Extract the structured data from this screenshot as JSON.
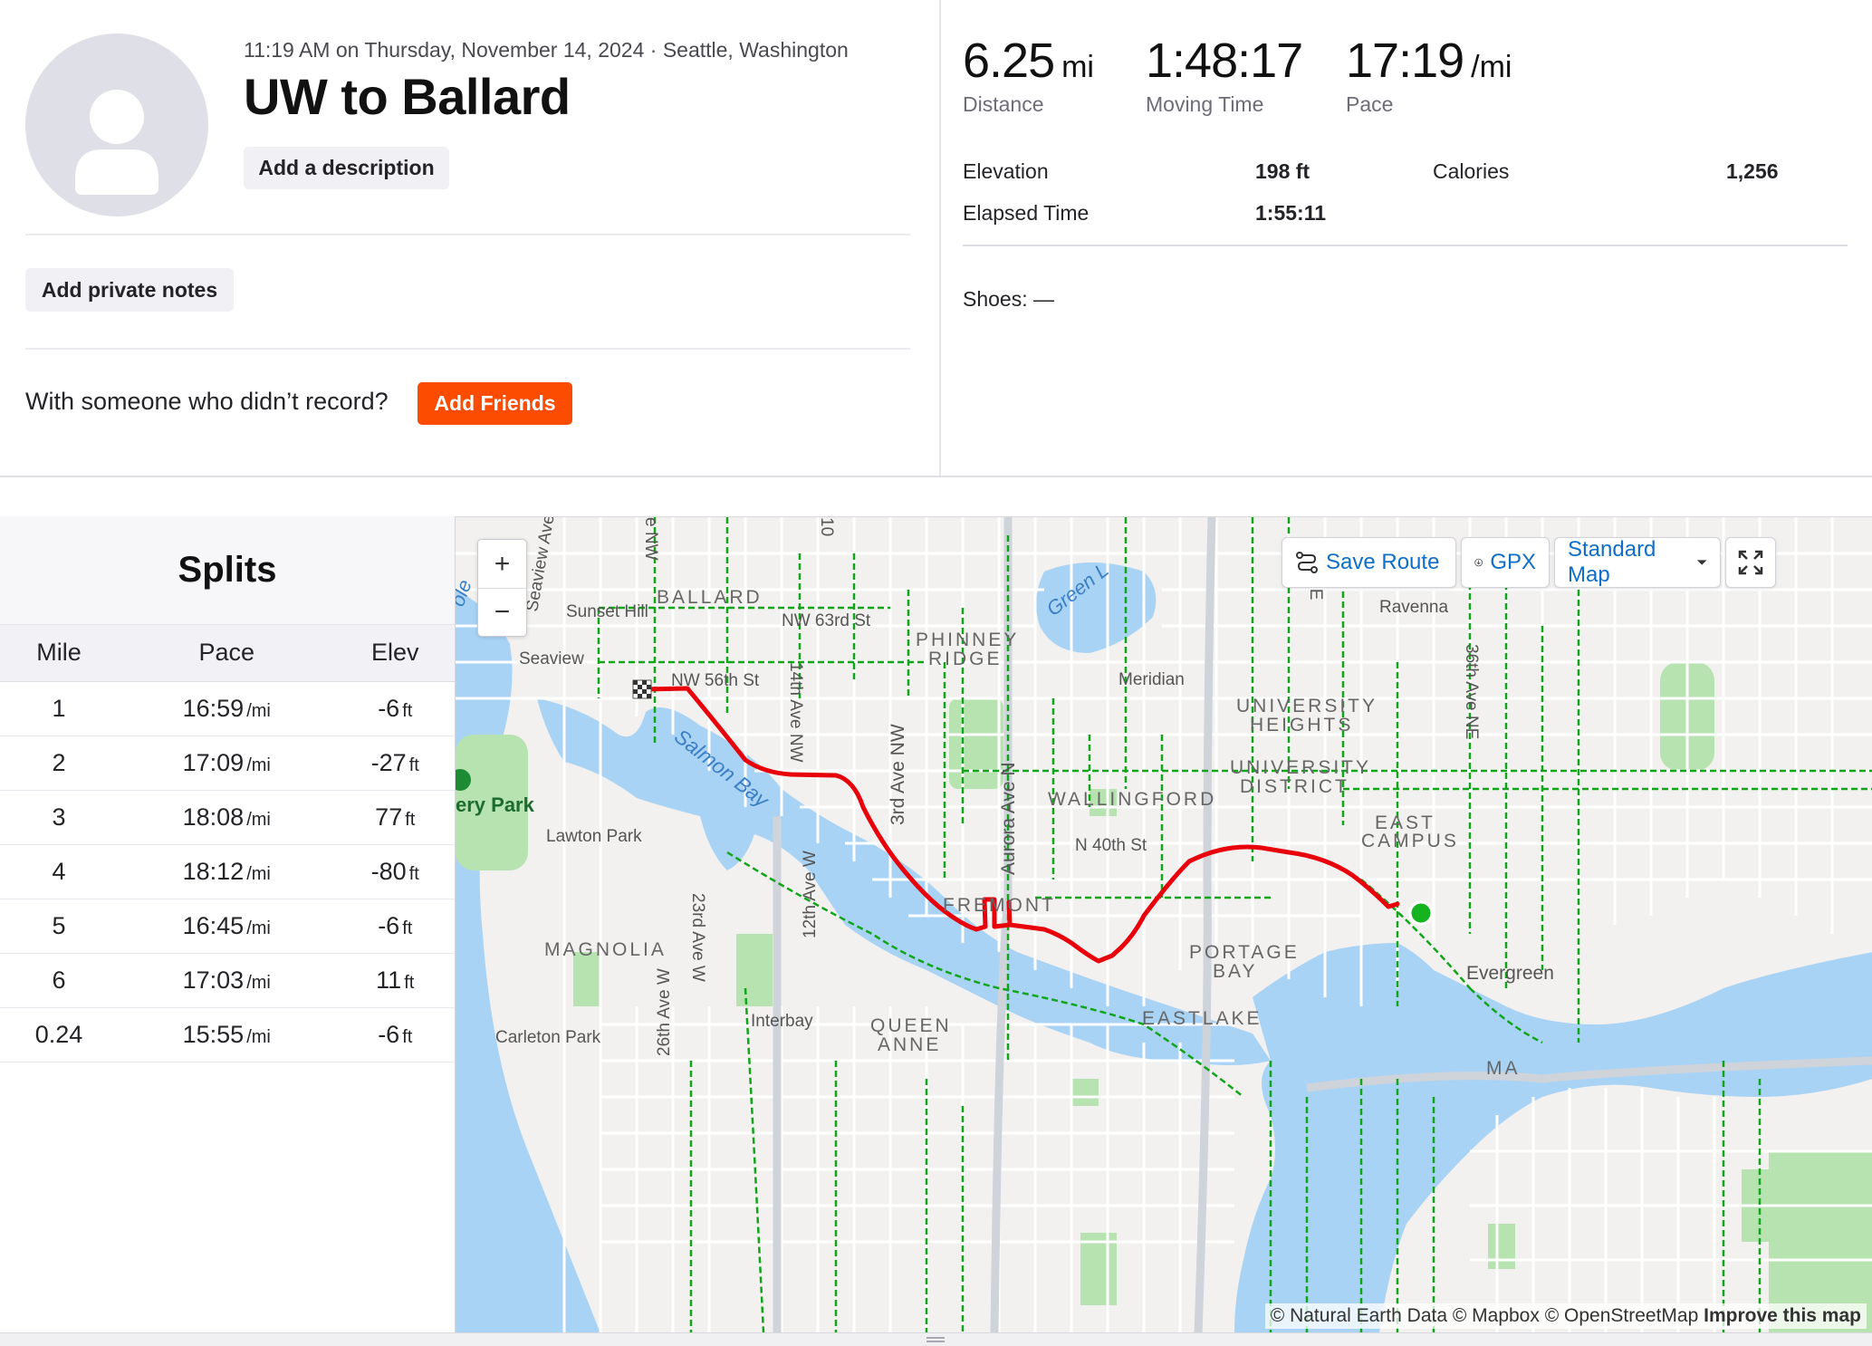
{
  "activity": {
    "datetime": "11:19 AM on Thursday, November 14, 2024 · Seattle, Washington",
    "title": "UW to Ballard",
    "add_description": "Add a description",
    "add_private_notes": "Add private notes",
    "with_someone": "With someone who didn’t record?",
    "add_friends": "Add Friends"
  },
  "stats": {
    "distance": {
      "value": "6.25",
      "unit": "mi",
      "label": "Distance"
    },
    "moving_time": {
      "value": "1:48:17",
      "label": "Moving Time"
    },
    "pace": {
      "value": "17:19",
      "unit": "/mi",
      "label": "Pace"
    },
    "elevation_label": "Elevation",
    "elevation_value": "198 ft",
    "calories_label": "Calories",
    "calories_value": "1,256",
    "elapsed_label": "Elapsed Time",
    "elapsed_value": "1:55:11",
    "shoes": "Shoes: —"
  },
  "splits": {
    "title": "Splits",
    "columns": [
      "Mile",
      "Pace",
      "Elev"
    ],
    "pace_unit": "/mi",
    "elev_unit": "ft",
    "rows": [
      {
        "mile": "1",
        "pace": "16:59",
        "elev": "-6"
      },
      {
        "mile": "2",
        "pace": "17:09",
        "elev": "-27"
      },
      {
        "mile": "3",
        "pace": "18:08",
        "elev": "77"
      },
      {
        "mile": "4",
        "pace": "18:12",
        "elev": "-80"
      },
      {
        "mile": "5",
        "pace": "16:45",
        "elev": "-6"
      },
      {
        "mile": "6",
        "pace": "17:03",
        "elev": "11"
      },
      {
        "mile": "0.24",
        "pace": "15:55",
        "elev": "-6"
      }
    ]
  },
  "map": {
    "zoom_in": "+",
    "zoom_out": "−",
    "save_route": "Save Route",
    "gpx": "GPX",
    "map_type": "Standard Map",
    "attribution": "© Natural Earth Data © Mapbox © OpenStreetMap",
    "improve": "Improve this map",
    "labels": {
      "ballard": "BALLARD",
      "sunset_hill": "Sunset Hill",
      "nw63": "NW 63rd St",
      "nw56": "NW 56th St",
      "seaview": "Seaview",
      "seaview_ave": "Seaview Ave",
      "salmon_bay": "Salmon Bay",
      "phinney": "PHINNEY",
      "ridge": "RIDGE",
      "green_lake": "Green L",
      "meridian": "Meridian",
      "ravenna": "Ravenna",
      "university": "UNIVERSITY",
      "heights": "HEIGHTS",
      "university2": "UNIVERSITY",
      "district": "DISTRICT",
      "wallingford": "WALLINGFORD",
      "n40": "N 40th St",
      "east": "EAST",
      "campus": "CAMPUS",
      "fremont": "FREMONT",
      "portage": "PORTAGE",
      "bay": "BAY",
      "eastlake": "EASTLAKE",
      "queen": "QUEEN",
      "anne": "ANNE",
      "magnolia": "MAGNOLIA",
      "lawton": "Lawton Park",
      "discovery": "ery Park",
      "interbay": "Interbay",
      "carleton": "Carleton Park",
      "evergreen": "Evergreen",
      "av14": "14th Ave NW",
      "av3": "3rd Ave NW",
      "aurora": "Aurora Ave N",
      "av12": "12th Ave W",
      "av23": "23rd Ave W",
      "av26": "26th Ave W",
      "av36": "36th Ave NE",
      "ne_top": "NE",
      "nw_top": "e NW",
      "o_top": "10",
      "ma": "MA",
      "ole": "ole"
    }
  },
  "colors": {
    "accent": "#fc4c02",
    "route": "#e8000b",
    "water": "#a9d3f5",
    "park": "#b6e3b0",
    "bikepath": "#11a51a",
    "link": "#0f6ec7"
  }
}
